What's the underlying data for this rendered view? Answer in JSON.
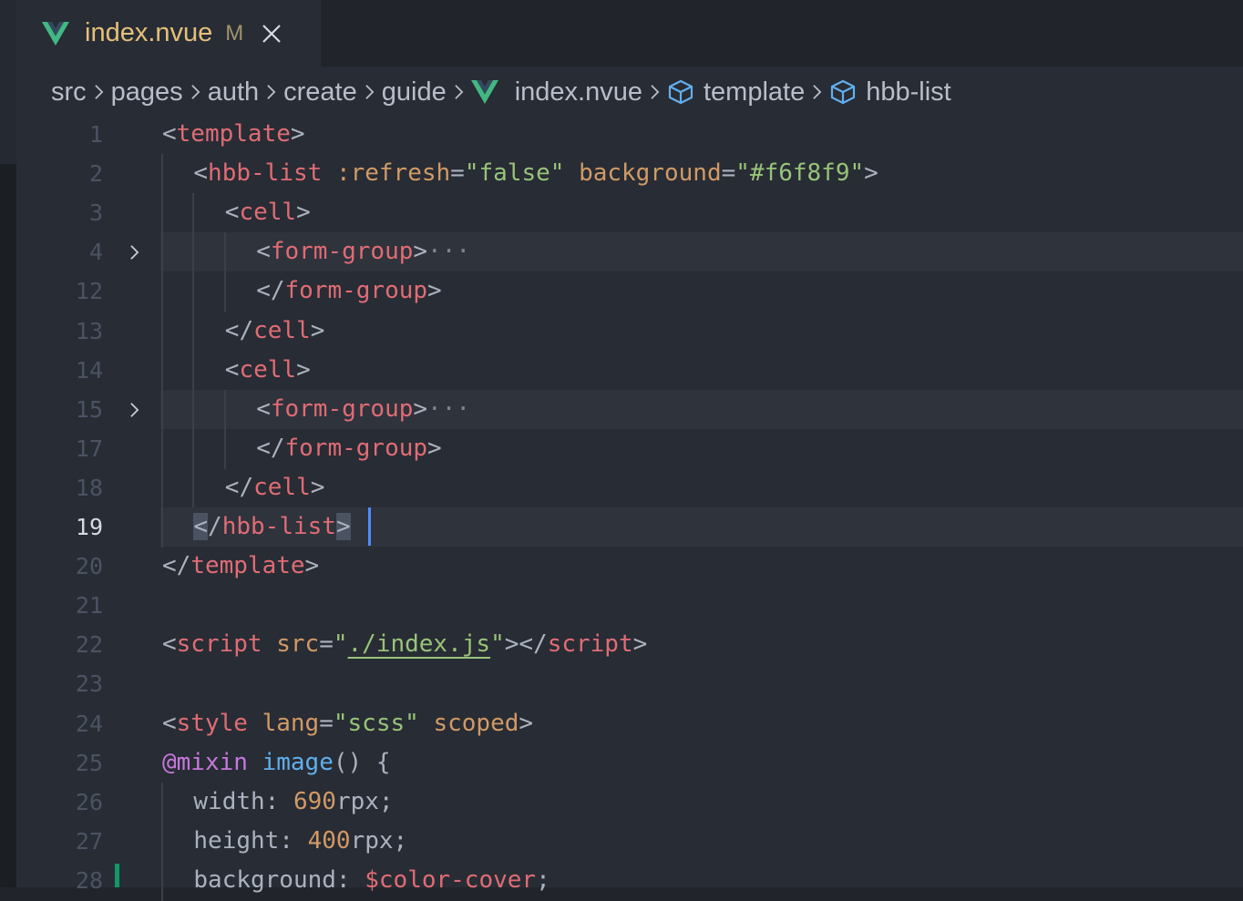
{
  "tab": {
    "filename": "index.nvue",
    "status": "M"
  },
  "breadcrumb": [
    {
      "label": "src",
      "icon": ""
    },
    {
      "label": "pages",
      "icon": ""
    },
    {
      "label": "auth",
      "icon": ""
    },
    {
      "label": "create",
      "icon": ""
    },
    {
      "label": "guide",
      "icon": ""
    },
    {
      "label": "index.nvue",
      "icon": "vue-icon"
    },
    {
      "label": "template",
      "icon": "symbol-class-icon"
    },
    {
      "label": "hbb-list",
      "icon": "symbol-class-icon"
    }
  ],
  "colors": {
    "tag": "#e06c75",
    "attribute": "#d19a66",
    "string": "#98c379",
    "keyword": "#c678dd",
    "function": "#61afef",
    "number": "#d19a66",
    "plain": "#abb2bf",
    "vue_green": "#42b883",
    "vue_dark": "#35495e",
    "cursor": "#528bff"
  },
  "editor": {
    "cursor_line": "19",
    "lines": [
      {
        "num": "1",
        "indent": 0,
        "folded": false,
        "tokens": [
          [
            "<",
            "p"
          ],
          [
            "template",
            "t"
          ],
          [
            ">",
            "p"
          ]
        ]
      },
      {
        "num": "2",
        "indent": 1,
        "folded": false,
        "tokens": [
          [
            "<",
            "p"
          ],
          [
            "hbb-list",
            "t"
          ],
          [
            " ",
            ""
          ],
          [
            ":refresh",
            "a"
          ],
          [
            "=",
            "p"
          ],
          [
            "\"false\"",
            "s"
          ],
          [
            " ",
            ""
          ],
          [
            "background",
            "a"
          ],
          [
            "=",
            "p"
          ],
          [
            "\"#f6f8f9\"",
            "s"
          ],
          [
            ">",
            "p"
          ]
        ]
      },
      {
        "num": "3",
        "indent": 2,
        "folded": false,
        "tokens": [
          [
            "<",
            "p"
          ],
          [
            "cell",
            "t"
          ],
          [
            ">",
            "p"
          ]
        ]
      },
      {
        "num": "4",
        "indent": 3,
        "folded": true,
        "tokens": [
          [
            "<",
            "p"
          ],
          [
            "form-group",
            "t"
          ],
          [
            ">",
            "p"
          ],
          [
            "···",
            "dots"
          ]
        ]
      },
      {
        "num": "12",
        "indent": 3,
        "folded": false,
        "tokens": [
          [
            "</",
            "p"
          ],
          [
            "form-group",
            "t"
          ],
          [
            ">",
            "p"
          ]
        ]
      },
      {
        "num": "13",
        "indent": 2,
        "folded": false,
        "tokens": [
          [
            "</",
            "p"
          ],
          [
            "cell",
            "t"
          ],
          [
            ">",
            "p"
          ]
        ]
      },
      {
        "num": "14",
        "indent": 2,
        "folded": false,
        "tokens": [
          [
            "<",
            "p"
          ],
          [
            "cell",
            "t"
          ],
          [
            ">",
            "p"
          ]
        ]
      },
      {
        "num": "15",
        "indent": 3,
        "folded": true,
        "tokens": [
          [
            "<",
            "p"
          ],
          [
            "form-group",
            "t"
          ],
          [
            ">",
            "p"
          ],
          [
            "···",
            "dots"
          ]
        ]
      },
      {
        "num": "17",
        "indent": 3,
        "folded": false,
        "tokens": [
          [
            "</",
            "p"
          ],
          [
            "form-group",
            "t"
          ],
          [
            ">",
            "p"
          ]
        ]
      },
      {
        "num": "18",
        "indent": 2,
        "folded": false,
        "tokens": [
          [
            "</",
            "p"
          ],
          [
            "cell",
            "t"
          ],
          [
            ">",
            "p"
          ]
        ]
      },
      {
        "num": "19",
        "indent": 1,
        "folded": false,
        "tokens": [
          [
            "<",
            "p bm"
          ],
          [
            "/",
            "p"
          ],
          [
            "hbb-list",
            "t"
          ],
          [
            ">",
            "p bm"
          ]
        ]
      },
      {
        "num": "20",
        "indent": 0,
        "folded": false,
        "tokens": [
          [
            "</",
            "p"
          ],
          [
            "template",
            "t"
          ],
          [
            ">",
            "p"
          ]
        ]
      },
      {
        "num": "21",
        "indent": 0,
        "folded": false,
        "tokens": []
      },
      {
        "num": "22",
        "indent": 0,
        "folded": false,
        "tokens": [
          [
            "<",
            "p"
          ],
          [
            "script",
            "t"
          ],
          [
            " ",
            ""
          ],
          [
            "src",
            "a"
          ],
          [
            "=",
            "p"
          ],
          [
            "\"",
            "s"
          ],
          [
            "./index.js",
            "s u"
          ],
          [
            "\"",
            "s"
          ],
          [
            "></",
            "p"
          ],
          [
            "script",
            "t"
          ],
          [
            ">",
            "p"
          ]
        ]
      },
      {
        "num": "23",
        "indent": 0,
        "folded": false,
        "tokens": []
      },
      {
        "num": "24",
        "indent": 0,
        "folded": false,
        "tokens": [
          [
            "<",
            "p"
          ],
          [
            "style",
            "t"
          ],
          [
            " ",
            ""
          ],
          [
            "lang",
            "a"
          ],
          [
            "=",
            "p"
          ],
          [
            "\"scss\"",
            "s"
          ],
          [
            " ",
            ""
          ],
          [
            "scoped",
            "a"
          ],
          [
            ">",
            "p"
          ]
        ]
      },
      {
        "num": "25",
        "indent": 0,
        "folded": false,
        "tokens": [
          [
            "@mixin",
            "k"
          ],
          [
            " ",
            ""
          ],
          [
            "image",
            "f"
          ],
          [
            "() {",
            "p"
          ]
        ]
      },
      {
        "num": "26",
        "indent": 1,
        "folded": false,
        "tokens": [
          [
            "width: ",
            "p"
          ],
          [
            "690",
            "n"
          ],
          [
            "rpx;",
            "p"
          ]
        ]
      },
      {
        "num": "27",
        "indent": 1,
        "folded": false,
        "tokens": [
          [
            "height: ",
            "p"
          ],
          [
            "400",
            "n"
          ],
          [
            "rpx;",
            "p"
          ]
        ]
      },
      {
        "num": "28",
        "indent": 1,
        "folded": false,
        "tokens": [
          [
            "background: ",
            "p"
          ],
          [
            "$color-cover",
            "t"
          ],
          [
            ";",
            "p"
          ]
        ]
      }
    ]
  }
}
